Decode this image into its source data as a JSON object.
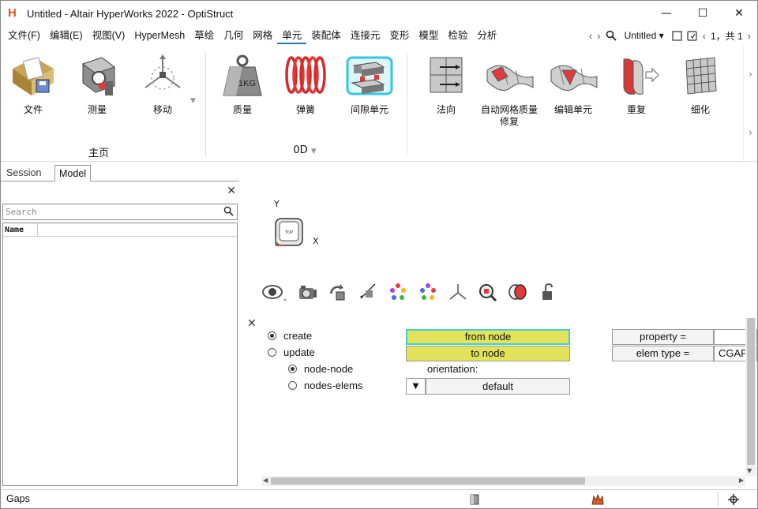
{
  "window": {
    "title": "Untitled - Altair HyperWorks 2022 - OptiStruct",
    "logo": "H",
    "minimize": "—",
    "maximize": "☐",
    "close": "✕"
  },
  "menu": {
    "items": [
      "文件(F)",
      "编辑(E)",
      "视图(V)",
      "HyperMesh",
      "草绘",
      "几何",
      "网格",
      "单元",
      "装配体",
      "连接元",
      "变形",
      "模型",
      "检验",
      "分析"
    ],
    "active_index": 7,
    "model_name": "Untitled",
    "page_indicator": "1，共 1"
  },
  "ribbon": {
    "home": {
      "buttons": [
        {
          "label": "文件",
          "icon": "file-folder-icon"
        },
        {
          "label": "测量",
          "icon": "measure-icon"
        },
        {
          "label": "移动",
          "icon": "move-icon"
        }
      ],
      "group_label": "主页"
    },
    "od": {
      "buttons": [
        {
          "label": "质量",
          "icon": "mass-weight-icon",
          "text": "1KG"
        },
        {
          "label": "弹簧",
          "icon": "spring-icon"
        },
        {
          "label": "间隙单元",
          "icon": "gap-element-icon"
        }
      ],
      "group_label": "0D"
    },
    "edit": {
      "buttons": [
        {
          "label": "法向",
          "icon": "normal-icon"
        },
        {
          "label": "自动网格质量修复",
          "icon": "auto-mesh-quality-icon"
        },
        {
          "label": "编辑单元",
          "icon": "edit-element-icon"
        },
        {
          "label": "重复",
          "icon": "repeat-icon"
        },
        {
          "label": "细化",
          "icon": "refine-icon"
        }
      ]
    }
  },
  "left_panel": {
    "tabs": [
      "Session",
      "Model"
    ],
    "active_tab": "Model",
    "search_placeholder": "Search",
    "tree_column": "Name"
  },
  "axis": {
    "y": "Y",
    "x": "X",
    "cube_label": "TOP"
  },
  "gap_panel": {
    "modes": [
      {
        "label": "create",
        "selected": true
      },
      {
        "label": "update",
        "selected": false
      }
    ],
    "submodes": [
      {
        "label": "node-node",
        "selected": true
      },
      {
        "label": "nodes-elems",
        "selected": false
      }
    ],
    "from_node": "from node",
    "to_node": "to node",
    "orientation_label": "orientation:",
    "orientation_value": "default",
    "property_label": "property =",
    "property_value": "",
    "elem_type_label": "elem type =",
    "elem_type_value": "CGAP"
  },
  "status": {
    "text": "Gaps"
  },
  "colors": {
    "accent": "#2a7ab0",
    "yellow_button": "#e2e35a",
    "focus_border": "#3fd3d0",
    "logo": "#e8531f"
  }
}
